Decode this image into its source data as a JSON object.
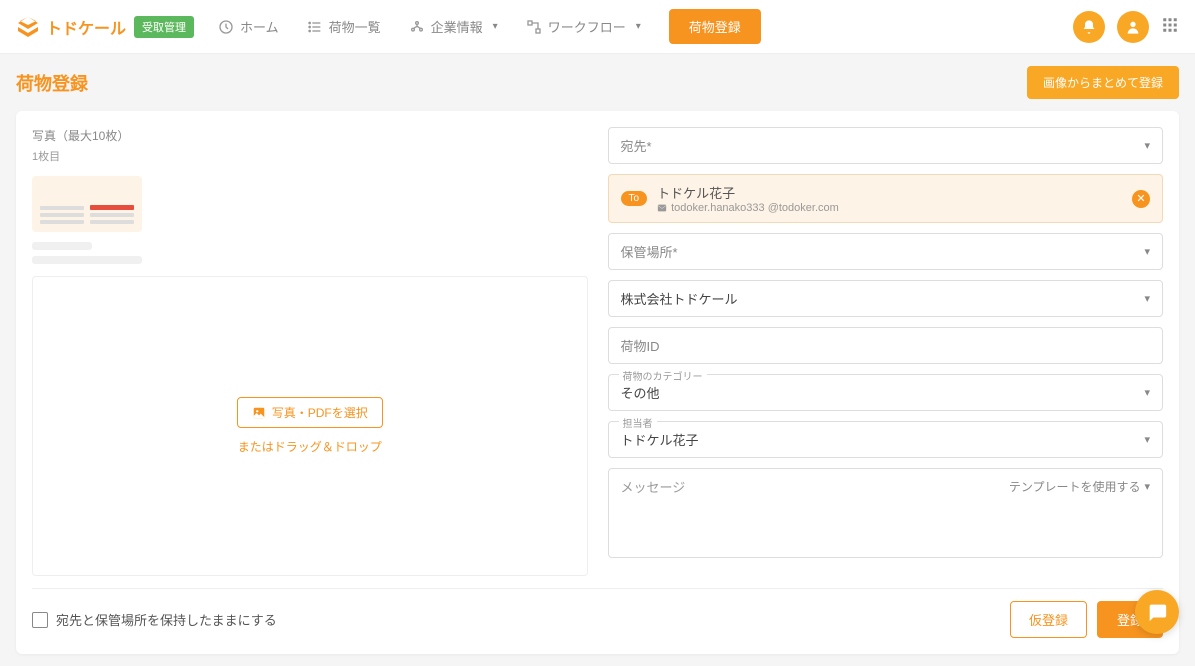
{
  "header": {
    "logo_text": "トドケール",
    "badge": "受取管理",
    "nav": {
      "home": "ホーム",
      "packages": "荷物一覧",
      "company": "企業情報",
      "workflow": "ワークフロー"
    },
    "register_btn": "荷物登録"
  },
  "page": {
    "title": "荷物登録",
    "bulk_btn": "画像からまとめて登録"
  },
  "photo": {
    "label": "写真（最大10枚）",
    "count": "1枚目",
    "select_btn": "写真・PDFを選択",
    "drop_hint": "またはドラッグ＆ドロップ"
  },
  "form": {
    "recipient_label": "宛先*",
    "recipient": {
      "to_badge": "To",
      "name": "トドケル花子",
      "email": "todoker.hanako333 @todoker.com"
    },
    "storage_label": "保管場所*",
    "company_value": "株式会社トドケール",
    "package_id_label": "荷物ID",
    "category_float": "荷物のカテゴリー",
    "category_value": "その他",
    "assignee_float": "担当者",
    "assignee_value": "トドケル花子",
    "message_placeholder": "メッセージ",
    "template_link": "テンプレートを使用する"
  },
  "footer": {
    "checkbox_label": "宛先と保管場所を保持したままにする",
    "draft_btn": "仮登録",
    "submit_btn": "登録"
  }
}
